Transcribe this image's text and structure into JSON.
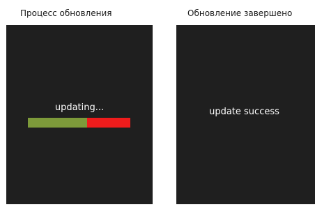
{
  "panels": {
    "left": {
      "caption": "Процесс обновления",
      "status_text": "updating...",
      "progress": {
        "fraction_complete": 0.58,
        "complete_color": "#7d9a3a",
        "remaining_color": "#ee1c1c"
      }
    },
    "right": {
      "caption": "Обновление завершено",
      "status_text": "update success"
    }
  },
  "colors": {
    "screen_background": "#1f1f1f",
    "screen_text": "#ffffff"
  }
}
